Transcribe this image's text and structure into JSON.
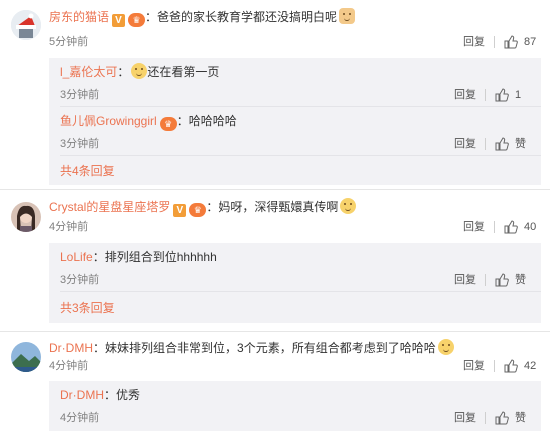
{
  "comments": [
    {
      "username": "房东的猫语",
      "text": "爸爸的家长教育学都还没搞明白呢",
      "time": "5分钟前",
      "reply_label": "回复",
      "likes": "87",
      "avatar_icon": "christmas-hat-avatar",
      "replies": [
        {
          "username": "l_嘉伦太可",
          "text": "还在看第一页",
          "time": "3分钟前",
          "reply_label": "回复",
          "likes": "1"
        },
        {
          "username": "鱼儿佩Growinggirl",
          "text": "哈哈哈哈",
          "time": "3分钟前",
          "reply_label": "回复",
          "likes": "赞"
        }
      ],
      "more_replies": "共4条回复"
    },
    {
      "username": "Crystal的星盘星座塔罗",
      "text": "妈呀，深得甄嬛真传啊",
      "time": "4分钟前",
      "reply_label": "回复",
      "likes": "40",
      "avatar_icon": "girl-photo-avatar",
      "replies": [
        {
          "username": "LoLife",
          "text": "排列组合到位hhhhhh",
          "time": "3分钟前",
          "reply_label": "回复",
          "likes": "赞"
        }
      ],
      "more_replies": "共3条回复"
    },
    {
      "username": "Dr·DMH",
      "text": "妹妹排列组合非常到位，3个元素，所有组合都考虑到了哈哈哈",
      "time": "4分钟前",
      "reply_label": "回复",
      "likes": "42",
      "avatar_icon": "landscape-avatar",
      "replies": [
        {
          "username": "Dr·DMH",
          "text": "优秀",
          "time": "4分钟前",
          "reply_label": "回复",
          "likes": "赞"
        }
      ]
    }
  ],
  "colors": {
    "username": "#eb7350",
    "reply_bg": "#f2f2f5",
    "text": "#333333",
    "meta": "#808080"
  }
}
